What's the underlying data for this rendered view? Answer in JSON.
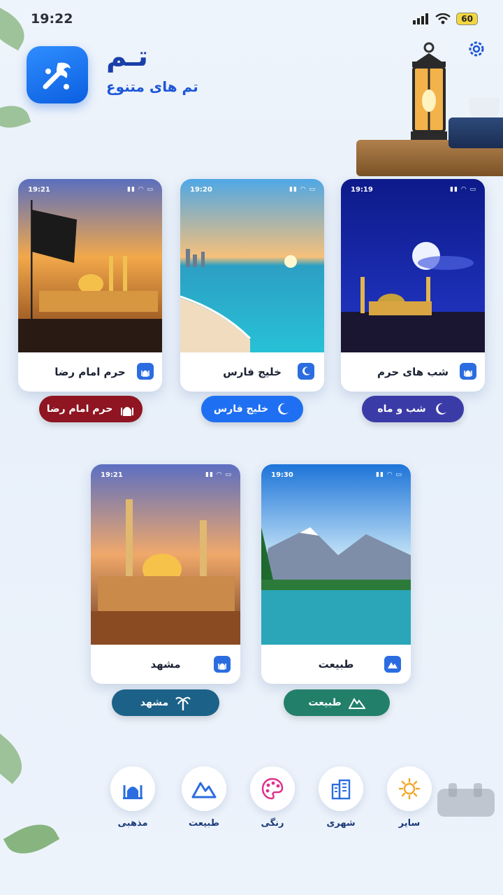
{
  "status_bar": {
    "time": "19:22",
    "battery": "60"
  },
  "header": {
    "title": "تـم",
    "subtitle": "تم های متنوع"
  },
  "cards": [
    {
      "label": "شب های حرم",
      "time": "19:19"
    },
    {
      "label": "خلیج فارس",
      "time": "19:20"
    },
    {
      "label": "حرم امام رضا",
      "time": "19:21"
    },
    {
      "label": "طبیعت",
      "time": "19:30"
    },
    {
      "label": "مشهد",
      "time": "19:21"
    }
  ],
  "pills": [
    {
      "label": "شب و ماه",
      "color": "#3b3ba8"
    },
    {
      "label": "خلیج فارس",
      "color": "#1f6ff2"
    },
    {
      "label": "حرم امام رضا",
      "color": "#8e1521"
    },
    {
      "label": "طبیعت",
      "color": "#22806a"
    },
    {
      "label": "مشهد",
      "color": "#1c6188"
    }
  ],
  "nav": [
    {
      "label": "سایر",
      "icon": "sun-icon"
    },
    {
      "label": "شهری",
      "icon": "building-icon"
    },
    {
      "label": "رنگی",
      "icon": "palette-icon"
    },
    {
      "label": "طبیعت",
      "icon": "mountain-icon"
    },
    {
      "label": "مذهبی",
      "icon": "mosque-icon"
    }
  ]
}
